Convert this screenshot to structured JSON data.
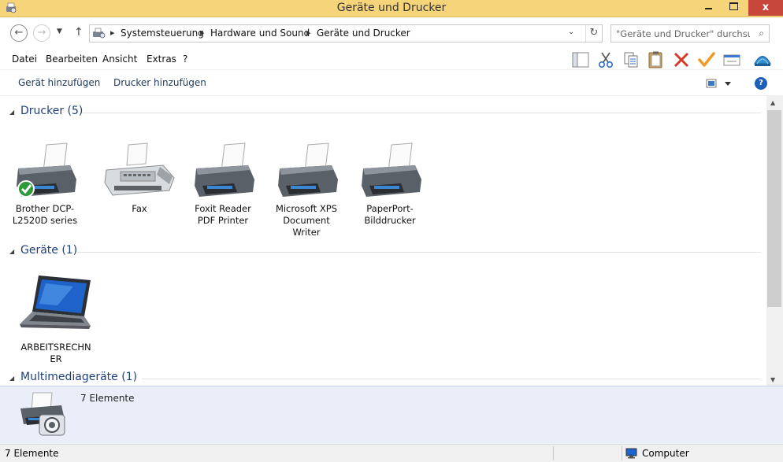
{
  "window": {
    "title": "Geräte und Drucker",
    "close_glyph": "x"
  },
  "address": {
    "breadcrumbs": [
      "Systemsteuerung",
      "Hardware und Sound",
      "Geräte und Drucker"
    ],
    "search_placeholder": "\"Geräte und Drucker\" durchsu..."
  },
  "menu": {
    "items": [
      "Datei",
      "Bearbeiten",
      "Ansicht",
      "Extras",
      "?"
    ]
  },
  "toolbar_icons": [
    "layout-pane-icon",
    "cut-icon",
    "copy-icon",
    "paste-icon",
    "delete-icon",
    "checkmark-icon",
    "properties-icon",
    "shell-icon"
  ],
  "commands": {
    "add_device": "Gerät hinzufügen",
    "add_printer": "Drucker hinzufügen",
    "help": "?"
  },
  "groups": {
    "printers": {
      "header": "Drucker (5)",
      "items": [
        {
          "label": "Brother DCP-L2520D series",
          "icon": "printer-default-icon",
          "default": true
        },
        {
          "label": "Fax",
          "icon": "fax-icon"
        },
        {
          "label": "Foxit Reader PDF Printer",
          "icon": "printer-icon"
        },
        {
          "label": "Microsoft XPS Document Writer",
          "icon": "printer-icon"
        },
        {
          "label": "PaperPort-Bilddrucker",
          "icon": "printer-icon"
        }
      ]
    },
    "devices": {
      "header": "Geräte (1)",
      "items": [
        {
          "label": "ARBEITSRECHNER",
          "icon": "laptop-icon"
        }
      ]
    },
    "multimedia": {
      "header": "Multimediageräte (1)"
    }
  },
  "details": {
    "count": "7 Elemente"
  },
  "status": {
    "left": "7 Elemente",
    "right": "Computer"
  },
  "colors": {
    "titlebar": "#f6d47a",
    "close": "#c7473a",
    "group_header": "#1e3f7a",
    "details_bg": "#e9eef8"
  }
}
